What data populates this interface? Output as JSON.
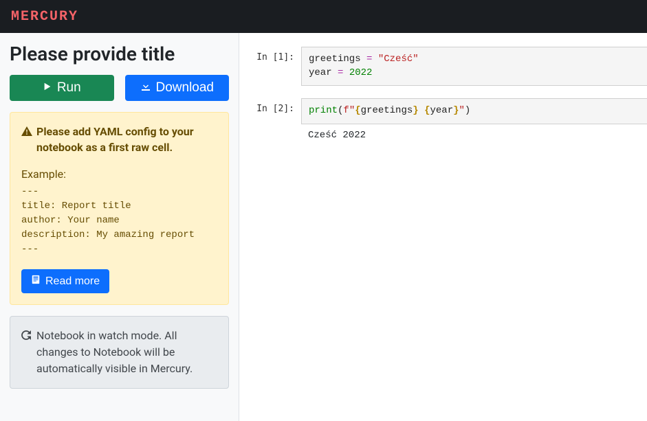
{
  "brand": "MERCURY",
  "sidebar": {
    "title": "Please provide title",
    "run_label": "Run",
    "download_label": "Download",
    "warning": {
      "heading": "Please add YAML config to your notebook as a first raw cell.",
      "example_label": "Example:",
      "example_code": "---\ntitle: Report title\nauthor: Your name\ndescription: My amazing report\n---",
      "read_more_label": "Read more"
    },
    "watch_mode_text": "Notebook in watch mode. All changes to Notebook will be automatically visible in Mercury."
  },
  "cells": [
    {
      "prompt": "In [1]:",
      "tokens": [
        [
          [
            "greetings",
            "var"
          ],
          [
            " ",
            ""
          ],
          [
            "=",
            "op"
          ],
          [
            " ",
            ""
          ],
          [
            "\"Cześć\"",
            "str"
          ]
        ],
        [
          [
            "year",
            "var"
          ],
          [
            " ",
            ""
          ],
          [
            "=",
            "op"
          ],
          [
            " ",
            ""
          ],
          [
            "2022",
            "num"
          ]
        ]
      ]
    },
    {
      "prompt": "In [2]:",
      "tokens": [
        [
          [
            "print",
            "fn"
          ],
          [
            "(",
            "paren"
          ],
          [
            "f\"",
            "fstr-open"
          ],
          [
            "{",
            "brace"
          ],
          [
            "greetings",
            "var"
          ],
          [
            "}",
            "brace"
          ],
          [
            " ",
            "fstr-open"
          ],
          [
            "{",
            "brace"
          ],
          [
            "year",
            "var"
          ],
          [
            "}",
            "brace"
          ],
          [
            "\"",
            "fstr-open"
          ],
          [
            ")",
            "paren"
          ]
        ]
      ],
      "output": "Cześć 2022"
    }
  ]
}
